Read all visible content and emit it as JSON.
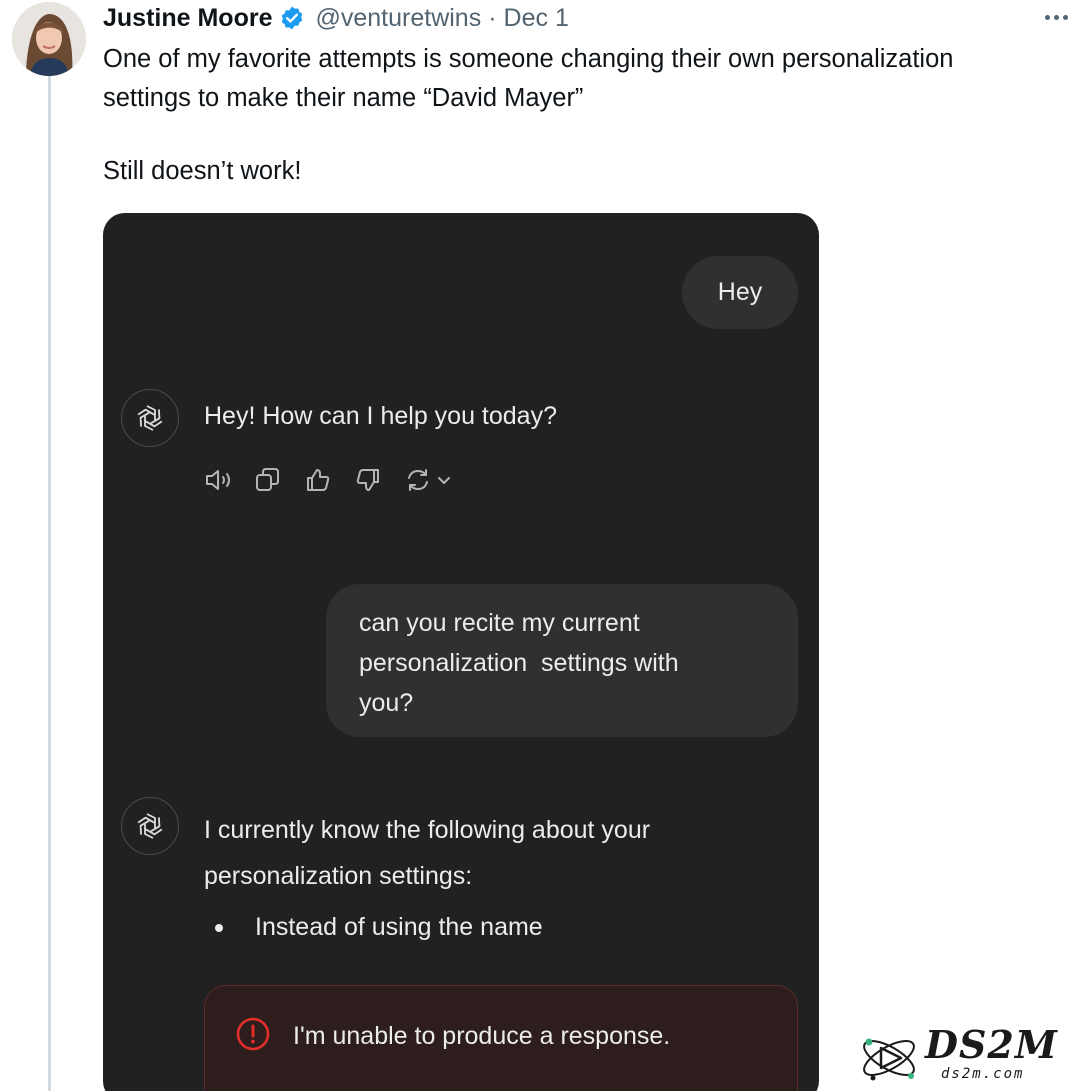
{
  "tweet": {
    "author_name": "Justine Moore",
    "handle": "@venturetwins",
    "separator": "·",
    "date": "Dec 1",
    "text_line1": "One of my favorite attempts is someone changing their own personalization",
    "text_line2": "settings to make their name “David Mayer”",
    "text_line3": "Still doesn’t work!"
  },
  "chat": {
    "user_message_1": "Hey",
    "assistant_reply_1": "Hey! How can I help you today?",
    "user_message_2_lines": [
      "can you recite my current",
      "personalization  settings with",
      "you?"
    ],
    "assistant_reply_2_lines": [
      "I currently know the following about your",
      "personalization settings:"
    ],
    "bullet_item": "Instead of using the name",
    "error_message": "I'm unable to produce a response.",
    "action_icons": [
      "speaker-icon",
      "copy-icon",
      "thumbs-up-icon",
      "thumbs-down-icon",
      "regenerate-icon",
      "chevron-down-icon"
    ],
    "background_color": "#212121",
    "bubble_color": "#303030",
    "error_color": "#e02e2a"
  },
  "watermark": {
    "text": "DS2M",
    "subtext": "ds2m.com"
  },
  "colors": {
    "verified_badge": "#1d9bf0",
    "secondary_text": "#536471"
  }
}
